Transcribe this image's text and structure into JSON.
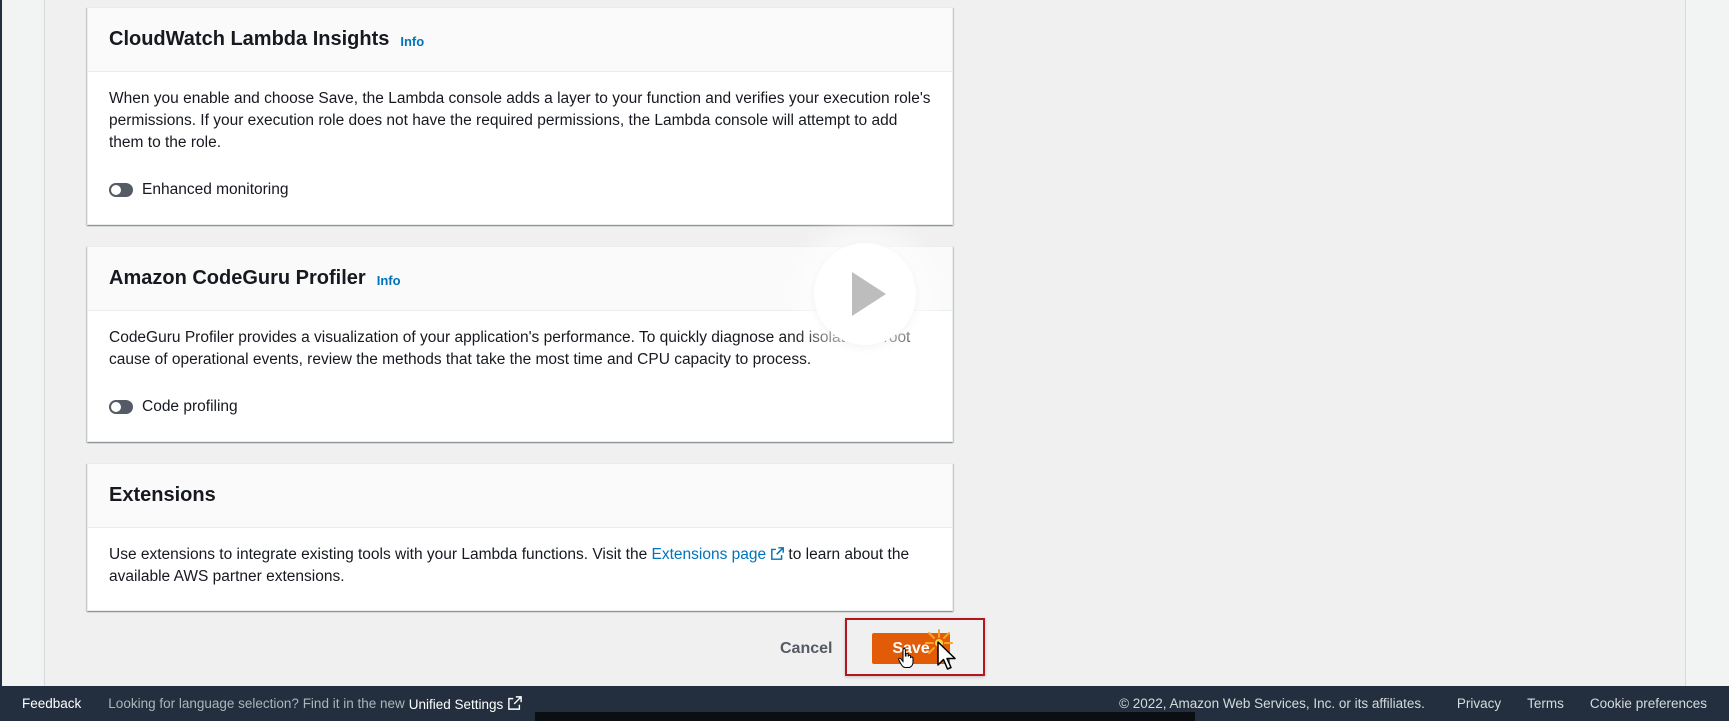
{
  "cards": {
    "insights": {
      "title": "CloudWatch Lambda Insights",
      "info": "Info",
      "description": "When you enable and choose Save, the Lambda console adds a layer to your function and verifies your execution role's permissions. If your execution role does not have the required permissions, the Lambda console will attempt to add them to the role.",
      "toggle_label": "Enhanced monitoring",
      "toggle_on": false
    },
    "codeguru": {
      "title": "Amazon CodeGuru Profiler",
      "info": "Info",
      "description": "CodeGuru Profiler provides a visualization of your application's performance. To quickly diagnose and isolate the root cause of operational events, review the methods that take the most time and CPU capacity to process.",
      "toggle_label": "Code profiling",
      "toggle_on": false
    },
    "extensions": {
      "title": "Extensions",
      "desc_before": "Use extensions to integrate existing tools with your Lambda functions. Visit the ",
      "link_text": "Extensions page",
      "desc_after": " to learn about the available AWS partner extensions."
    }
  },
  "actions": {
    "cancel_label": "Cancel",
    "save_label": "Save"
  },
  "footer": {
    "feedback": "Feedback",
    "lang_note": "Looking for language selection? Find it in the new",
    "unified_settings": "Unified Settings",
    "copyright": "© 2022, Amazon Web Services, Inc. or its affiliates.",
    "links": [
      "Privacy",
      "Terms",
      "Cookie preferences"
    ]
  },
  "colors": {
    "primary_button": "#e25c07",
    "link": "#0073bb",
    "footer_bg": "#232f3e",
    "highlight_border": "#b5161b"
  },
  "icons": [
    "play-icon",
    "external-link-icon",
    "cursor-arrow-icon",
    "cursor-hand-icon",
    "click-burst-icon"
  ]
}
